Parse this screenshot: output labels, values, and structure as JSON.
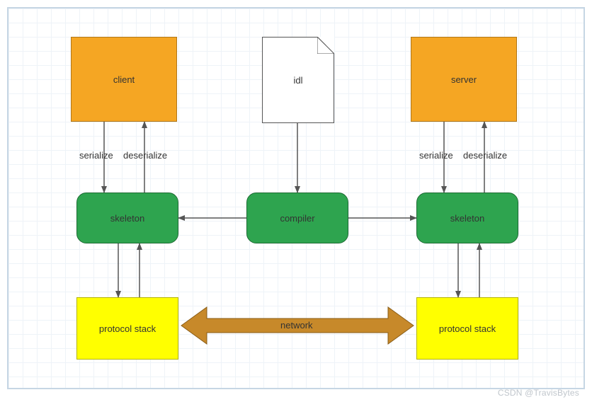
{
  "nodes": {
    "client": {
      "label": "client"
    },
    "server": {
      "label": "server"
    },
    "idl": {
      "label": "idl"
    },
    "compiler": {
      "label": "compiler"
    },
    "skeletonL": {
      "label": "skeleton"
    },
    "skeletonR": {
      "label": "skeleton"
    },
    "protoL": {
      "label": "protocol stack"
    },
    "protoR": {
      "label": "protocol stack"
    },
    "network": {
      "label": "network"
    }
  },
  "edges": {
    "serializeL": {
      "label": "serialize"
    },
    "deserializeL": {
      "label": "deserialize"
    },
    "serializeR": {
      "label": "serialize"
    },
    "deserializeR": {
      "label": "deserialize"
    }
  },
  "colors": {
    "orange": "#f5a623",
    "green": "#2ea44f",
    "yellow": "#ffff00",
    "networkArrow": "#c7892a",
    "grid": "#eef3f8",
    "frame": "#c6d6e4"
  },
  "watermark": "CSDN @TravisBytes"
}
